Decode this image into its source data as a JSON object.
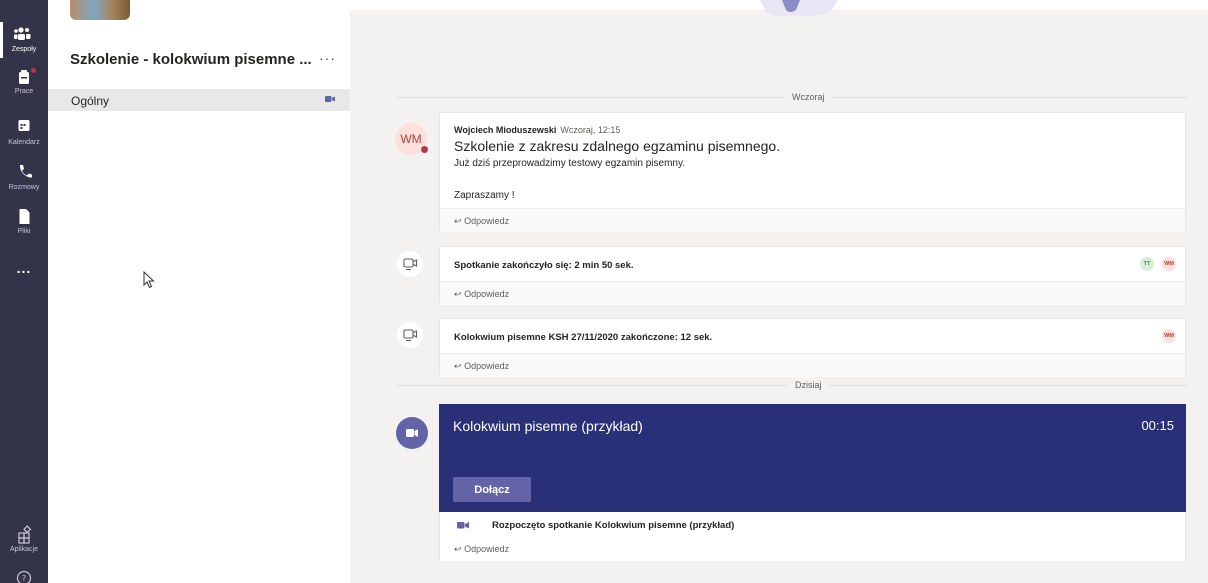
{
  "rail": {
    "items": [
      {
        "label": "Zespoły"
      },
      {
        "label": "Prace"
      },
      {
        "label": "Kalendarz"
      },
      {
        "label": "Rozmowy"
      },
      {
        "label": "Pliki"
      },
      {
        "label": "..."
      },
      {
        "label": "Aplikacje"
      }
    ]
  },
  "team": {
    "name": "Szkolenie - kolokwium pisemne ...",
    "more": "···",
    "channel": "Ogólny"
  },
  "feed": {
    "yesterday": "Wczoraj",
    "today": "Dzisiaj",
    "post": {
      "initials": "WM",
      "author": "Wojciech Mioduszewski",
      "time": "Wczoraj, 12:15",
      "subject": "Szkolenie z zakresu zdalnego egzaminu pisemnego.",
      "line1": "Już dziś przeprowadzimy testowy egzamin pisemny.",
      "line2": "Zapraszamy !"
    },
    "reply": "Odpowiedz",
    "meeting1": {
      "text": "Spotkanie zakończyło się: 2 min 50 sek.",
      "participants": [
        "TT",
        "WM"
      ]
    },
    "meeting2": {
      "text": "Kolokwium pisemne KSH 27/11/2020 zakończone: 12 sek.",
      "participants": [
        "WM"
      ]
    },
    "live": {
      "title": "Kolokwium pisemne (przykład)",
      "timer": "00:15",
      "join": "Dołącz",
      "started": "Rozpoczęto spotkanie Kolokwium pisemne (przykład)"
    }
  },
  "colors": {
    "rail": "#33344a",
    "accent": "#6264a7",
    "live_card": "#293078",
    "presence_busy": "#c4314b"
  }
}
